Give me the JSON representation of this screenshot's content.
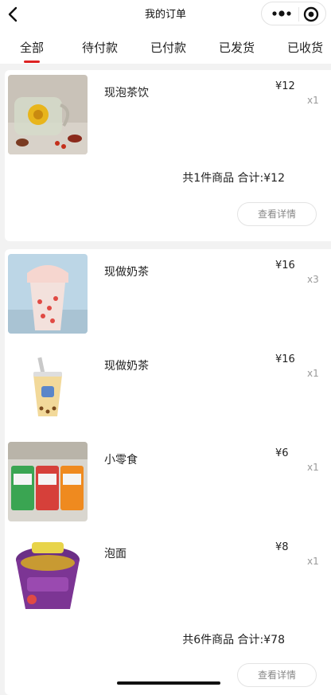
{
  "nav": {
    "title": "我的订单"
  },
  "tabs": [
    {
      "label": "全部"
    },
    {
      "label": "待付款"
    },
    {
      "label": "已付款"
    },
    {
      "label": "已发货"
    },
    {
      "label": "已收货"
    }
  ],
  "orders": [
    {
      "items": [
        {
          "name": "现泡茶饮",
          "price": "¥12",
          "qty": "x1",
          "image": "tea-photo"
        }
      ],
      "summary": "共1件商品 合计:¥12",
      "button_label": "查看详情"
    },
    {
      "items": [
        {
          "name": "现做奶茶",
          "price": "¥16",
          "qty": "x3",
          "image": "milk-tea-photo"
        },
        {
          "name": "现做奶茶",
          "price": "¥16",
          "qty": "x1",
          "image": "bubble-tea-photo"
        },
        {
          "name": "小零食",
          "price": "¥6",
          "qty": "x1",
          "image": "snack-photo"
        },
        {
          "name": "泡面",
          "price": "¥8",
          "qty": "x1",
          "image": "noodle-photo"
        }
      ],
      "summary": "共6件商品 合计:¥78",
      "button_label": "查看详情"
    }
  ]
}
